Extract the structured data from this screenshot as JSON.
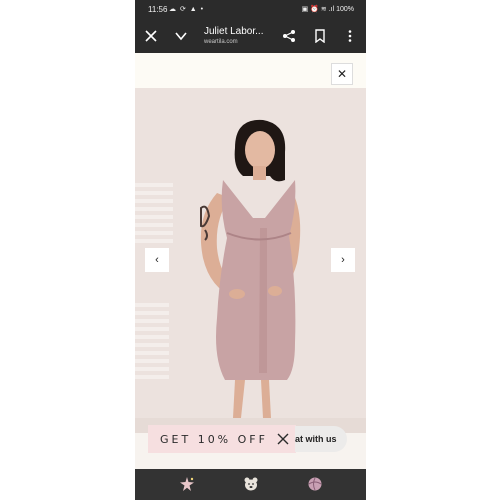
{
  "status_bar": {
    "time": "11:56",
    "left_icons": "☁ ⟳ ▲ •",
    "right_icons": "▣ ⏰ ≋ .ıl 100%",
    "icon_names": [
      "cloud-icon",
      "sync-icon",
      "notification-icon",
      "dot-icon",
      "vibrate-icon",
      "alarm-icon",
      "wifi-icon",
      "signal-icon",
      "battery-icon"
    ]
  },
  "browser": {
    "title": "Juliet Labor...",
    "url": "weartila.com",
    "icons": [
      "close-icon",
      "chevron-down-icon",
      "share-icon",
      "bookmark-icon",
      "more-vert-icon"
    ]
  },
  "modal": {
    "close_label": "✕",
    "prev_label": "‹",
    "next_label": "›"
  },
  "promo": {
    "text": "GET 10% OFF"
  },
  "chat": {
    "text": "at with us"
  },
  "bottom_nav": {
    "icons": [
      "sparkle-star-icon",
      "bear-icon",
      "ball-icon"
    ]
  },
  "colors": {
    "dark_bar": "#2b2b2b",
    "image_bg": "#ece2de",
    "dress": "#c8a3a4",
    "promo_bg": "#f6dfe0",
    "chat_bg": "#ecebea"
  }
}
